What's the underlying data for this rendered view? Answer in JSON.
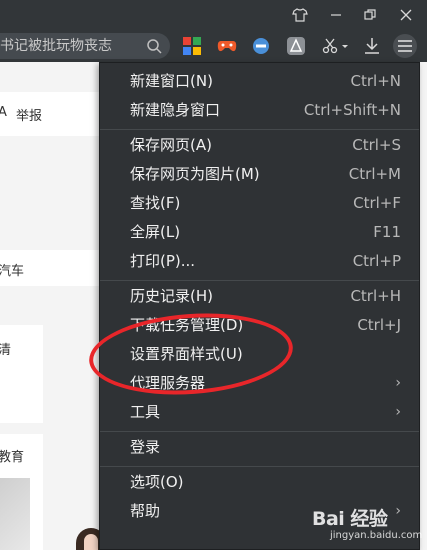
{
  "toolbar": {
    "search_text": "书记被批玩物丧志"
  },
  "page": {
    "report_label": "举报",
    "frag_a": "A",
    "frag_car": "汽车",
    "frag_qing": "清",
    "frag_edu": "教育"
  },
  "menu": {
    "items": [
      {
        "label": "新建窗口(N)",
        "shortcut": "Ctrl+N"
      },
      {
        "label": "新建隐身窗口",
        "shortcut": "Ctrl+Shift+N"
      },
      {
        "label": "保存网页(A)",
        "shortcut": "Ctrl+S"
      },
      {
        "label": "保存网页为图片(M)",
        "shortcut": "Ctrl+M"
      },
      {
        "label": "查找(F)",
        "shortcut": "Ctrl+F"
      },
      {
        "label": "全屏(L)",
        "shortcut": "F11"
      },
      {
        "label": "打印(P)...",
        "shortcut": "Ctrl+P"
      },
      {
        "label": "历史记录(H)",
        "shortcut": "Ctrl+H"
      },
      {
        "label": "下载任务管理(D)",
        "shortcut": "Ctrl+J"
      },
      {
        "label": "设置界面样式(U)",
        "shortcut": ""
      },
      {
        "label": "代理服务器",
        "shortcut": ""
      },
      {
        "label": "工具",
        "shortcut": ""
      },
      {
        "label": "登录",
        "shortcut": ""
      },
      {
        "label": "选项(O)",
        "shortcut": ""
      },
      {
        "label": "帮助",
        "shortcut": ""
      }
    ]
  },
  "watermark": {
    "logo": "Bai 经验",
    "url": "jingyan.baidu.com"
  },
  "colors": {
    "menu_bg": "#2f3235",
    "highlight": "#e8262a",
    "titlebar_bg": "#323639"
  }
}
